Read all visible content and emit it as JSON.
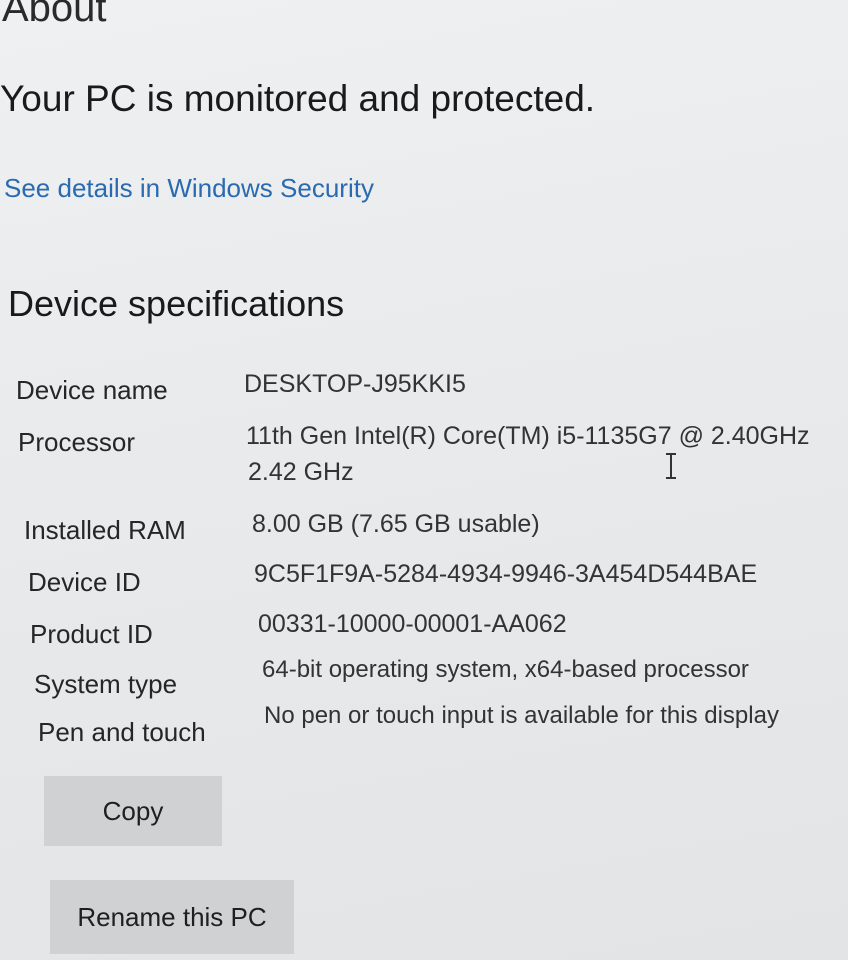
{
  "page": {
    "title": "About",
    "status": "Your PC is monitored and protected.",
    "security_link": "See details in Windows Security"
  },
  "device_specs": {
    "heading": "Device specifications",
    "rows": [
      {
        "label": "Device name",
        "value": "DESKTOP-J95KKI5",
        "value2": ""
      },
      {
        "label": "Processor",
        "value": "11th Gen Intel(R) Core(TM) i5-1135G7 @ 2.40GHz",
        "value2": "2.42 GHz"
      },
      {
        "label": "Installed RAM",
        "value": "8.00 GB (7.65 GB usable)",
        "value2": ""
      },
      {
        "label": "Device ID",
        "value": "9C5F1F9A-5284-4934-9946-3A454D544BAE",
        "value2": ""
      },
      {
        "label": "Product ID",
        "value": "00331-10000-00001-AA062",
        "value2": ""
      },
      {
        "label": "System type",
        "value": "64-bit operating system, x64-based processor",
        "value2": ""
      },
      {
        "label": "Pen and touch",
        "value": "No pen or touch input is available for this display",
        "value2": ""
      }
    ]
  },
  "buttons": {
    "copy": "Copy",
    "rename": "Rename this PC"
  },
  "icons": {
    "cursor": "text-cursor-icon"
  }
}
